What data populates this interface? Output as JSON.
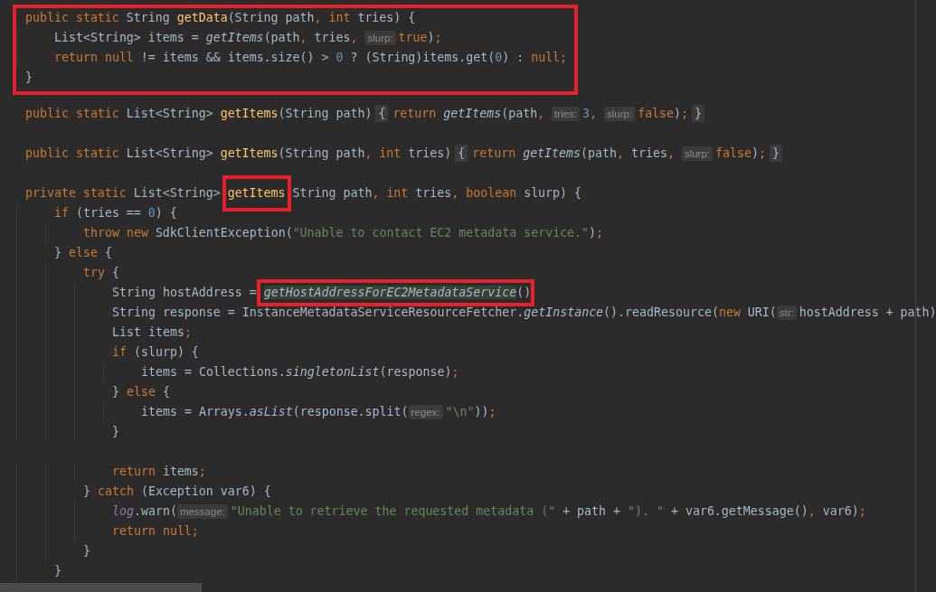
{
  "editor": {
    "blocks": [
      {
        "boxed": true,
        "lines": [
          {
            "tokens": [
              {
                "text": "public static ",
                "kind": "kw"
              },
              {
                "text": "String ",
                "kind": "plain"
              },
              {
                "text": "getData",
                "kind": "decl"
              },
              {
                "text": "(String path",
                "kind": "plain"
              },
              {
                "text": ", int ",
                "kind": "kw"
              },
              {
                "text": "tries) {",
                "kind": "plain"
              }
            ]
          },
          {
            "tokens": [
              {
                "text": "    List<String> items = ",
                "kind": "plain"
              },
              {
                "text": "getItems",
                "kind": "call"
              },
              {
                "text": "(path",
                "kind": "plain"
              },
              {
                "text": ", ",
                "kind": "kw"
              },
              {
                "text": "tries",
                "kind": "plain"
              },
              {
                "text": ", ",
                "kind": "kw"
              },
              {
                "text": "slurp:",
                "kind": "hint"
              },
              {
                "text": "true",
                "kind": "kw"
              },
              {
                "text": ")",
                "kind": "plain"
              },
              {
                "text": ";",
                "kind": "kw"
              }
            ]
          },
          {
            "tokens": [
              {
                "text": "    return null ",
                "kind": "kw"
              },
              {
                "text": "!= items && items.size() > ",
                "kind": "plain"
              },
              {
                "text": "0",
                "kind": "num"
              },
              {
                "text": " ? (String)items.get(",
                "kind": "plain"
              },
              {
                "text": "0",
                "kind": "num"
              },
              {
                "text": ") : ",
                "kind": "plain"
              },
              {
                "text": "null;",
                "kind": "kw"
              }
            ]
          },
          {
            "tokens": [
              {
                "text": "}",
                "kind": "plain"
              }
            ]
          }
        ]
      },
      {
        "boxed": false,
        "lines": [
          {
            "tokens": [
              {
                "text": "public static ",
                "kind": "kw"
              },
              {
                "text": "List<String> ",
                "kind": "plain"
              },
              {
                "text": "getItems",
                "kind": "decl"
              },
              {
                "text": "(String path)",
                "kind": "plain"
              },
              {
                "text": "{",
                "kind": "fold"
              },
              {
                "text": "return ",
                "kind": "kw"
              },
              {
                "text": "getItems",
                "kind": "call"
              },
              {
                "text": "(path",
                "kind": "plain"
              },
              {
                "text": ", ",
                "kind": "kw"
              },
              {
                "text": "tries:",
                "kind": "hint"
              },
              {
                "text": "3",
                "kind": "num"
              },
              {
                "text": ", ",
                "kind": "kw"
              },
              {
                "text": "slurp:",
                "kind": "hint"
              },
              {
                "text": "false",
                "kind": "kw"
              },
              {
                "text": ")",
                "kind": "plain"
              },
              {
                "text": ";",
                "kind": "kw"
              },
              {
                "text": "}",
                "kind": "fold"
              }
            ]
          }
        ]
      },
      {
        "boxed": false,
        "lines": [
          {
            "tokens": [
              {
                "text": "public static ",
                "kind": "kw"
              },
              {
                "text": "List<String> ",
                "kind": "plain"
              },
              {
                "text": "getItems",
                "kind": "decl"
              },
              {
                "text": "(String path",
                "kind": "plain"
              },
              {
                "text": ", int ",
                "kind": "kw"
              },
              {
                "text": "tries)",
                "kind": "plain"
              },
              {
                "text": "{",
                "kind": "fold"
              },
              {
                "text": "return ",
                "kind": "kw"
              },
              {
                "text": "getItems",
                "kind": "call"
              },
              {
                "text": "(path",
                "kind": "plain"
              },
              {
                "text": ", ",
                "kind": "kw"
              },
              {
                "text": "tries",
                "kind": "plain"
              },
              {
                "text": ", ",
                "kind": "kw"
              },
              {
                "text": "slurp:",
                "kind": "hint"
              },
              {
                "text": "false",
                "kind": "kw"
              },
              {
                "text": ")",
                "kind": "plain"
              },
              {
                "text": ";",
                "kind": "kw"
              },
              {
                "text": "}",
                "kind": "fold"
              }
            ]
          }
        ]
      },
      {
        "boxed": false,
        "lines": [
          {
            "tokens": [
              {
                "text": "private static ",
                "kind": "kw"
              },
              {
                "text": "List<String> ",
                "kind": "plain"
              },
              {
                "kind": "box",
                "tokens": [
                  {
                    "text": "getItems",
                    "kind": "decl"
                  }
                ]
              },
              {
                "text": "String path",
                "kind": "plain"
              },
              {
                "text": ", int ",
                "kind": "kw"
              },
              {
                "text": "tries",
                "kind": "plain"
              },
              {
                "text": ", boolean ",
                "kind": "kw"
              },
              {
                "text": "slurp) {",
                "kind": "plain"
              }
            ]
          },
          {
            "tokens": [
              {
                "text": "    if ",
                "kind": "kw"
              },
              {
                "text": "(tries == ",
                "kind": "plain"
              },
              {
                "text": "0",
                "kind": "num"
              },
              {
                "text": ") {",
                "kind": "plain"
              }
            ]
          },
          {
            "tokens": [
              {
                "text": "        throw new ",
                "kind": "kw"
              },
              {
                "text": "SdkClientException(",
                "kind": "plain"
              },
              {
                "text": "\"Unable to contact EC2 metadata service.\"",
                "kind": "str"
              },
              {
                "text": ")",
                "kind": "plain"
              },
              {
                "text": ";",
                "kind": "kw"
              }
            ]
          },
          {
            "tokens": [
              {
                "text": "    } ",
                "kind": "plain"
              },
              {
                "text": "else ",
                "kind": "kw"
              },
              {
                "text": "{",
                "kind": "plain"
              }
            ]
          },
          {
            "tokens": [
              {
                "text": "        try ",
                "kind": "kw"
              },
              {
                "text": "{",
                "kind": "plain"
              }
            ]
          },
          {
            "tokens": [
              {
                "text": "            String hostAddress = ",
                "kind": "plain"
              },
              {
                "kind": "box",
                "tokens": [
                  {
                    "text": "getHostAddressForEC2MetadataService",
                    "kind": "usage"
                  },
                  {
                    "text": "()",
                    "kind": "plain"
                  }
                ]
              }
            ]
          },
          {
            "tokens": [
              {
                "text": "            String response = InstanceMetadataServiceResourceFetcher.",
                "kind": "plain"
              },
              {
                "text": "getInstance",
                "kind": "call"
              },
              {
                "text": "().readResource(",
                "kind": "plain"
              },
              {
                "text": "new ",
                "kind": "kw"
              },
              {
                "text": "URI(",
                "kind": "plain"
              },
              {
                "text": "str:",
                "kind": "hint"
              },
              {
                "text": "hostAddress + path)",
                "kind": "plain"
              }
            ]
          },
          {
            "tokens": [
              {
                "text": "            List items",
                "kind": "plain"
              },
              {
                "text": ";",
                "kind": "kw"
              }
            ]
          },
          {
            "tokens": [
              {
                "text": "            if ",
                "kind": "kw"
              },
              {
                "text": "(slurp) {",
                "kind": "plain"
              }
            ]
          },
          {
            "tokens": [
              {
                "text": "                items = Collections.",
                "kind": "plain"
              },
              {
                "text": "singletonList",
                "kind": "call"
              },
              {
                "text": "(response)",
                "kind": "plain"
              },
              {
                "text": ";",
                "kind": "kw"
              }
            ]
          },
          {
            "tokens": [
              {
                "text": "            } ",
                "kind": "plain"
              },
              {
                "text": "else ",
                "kind": "kw"
              },
              {
                "text": "{",
                "kind": "plain"
              }
            ]
          },
          {
            "tokens": [
              {
                "text": "                items = Arrays.",
                "kind": "plain"
              },
              {
                "text": "asList",
                "kind": "call"
              },
              {
                "text": "(response.split(",
                "kind": "plain"
              },
              {
                "text": "regex:",
                "kind": "hint"
              },
              {
                "text": "\"\\n\"",
                "kind": "str"
              },
              {
                "text": "))",
                "kind": "plain"
              },
              {
                "text": ";",
                "kind": "kw"
              }
            ]
          },
          {
            "tokens": [
              {
                "text": "            }",
                "kind": "plain"
              }
            ]
          }
        ]
      },
      {
        "boxed": false,
        "lines": [
          {
            "tokens": [
              {
                "text": "            return ",
                "kind": "kw"
              },
              {
                "text": "items",
                "kind": "plain"
              },
              {
                "text": ";",
                "kind": "kw"
              }
            ]
          },
          {
            "tokens": [
              {
                "text": "        } ",
                "kind": "plain"
              },
              {
                "text": "catch ",
                "kind": "kw"
              },
              {
                "text": "(Exception var6) {",
                "kind": "plain"
              }
            ]
          },
          {
            "tokens": [
              {
                "text": "            log",
                "kind": "field"
              },
              {
                "text": ".warn(",
                "kind": "plain"
              },
              {
                "text": "message:",
                "kind": "hint"
              },
              {
                "text": "\"Unable to retrieve the requested metadata (\"",
                "kind": "str"
              },
              {
                "text": " + path + ",
                "kind": "plain"
              },
              {
                "text": "\"). \"",
                "kind": "str"
              },
              {
                "text": " + var6.getMessage()",
                "kind": "plain"
              },
              {
                "text": ", ",
                "kind": "kw"
              },
              {
                "text": "var6)",
                "kind": "plain"
              },
              {
                "text": ";",
                "kind": "kw"
              }
            ]
          },
          {
            "tokens": [
              {
                "text": "            return null;",
                "kind": "kw"
              }
            ]
          },
          {
            "tokens": [
              {
                "text": "        }",
                "kind": "plain"
              }
            ]
          },
          {
            "tokens": [
              {
                "text": "    }",
                "kind": "plain"
              }
            ]
          }
        ]
      }
    ]
  }
}
